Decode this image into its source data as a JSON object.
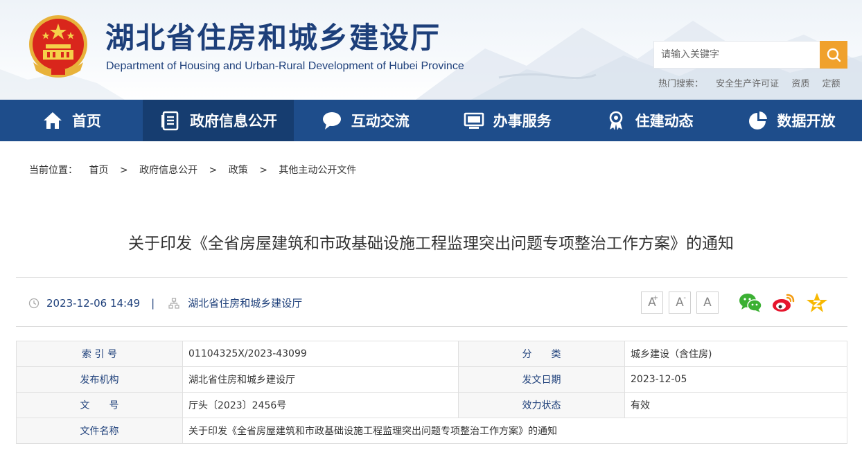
{
  "header": {
    "title": "湖北省住房和城乡建设厅",
    "subtitle": "Department of Housing and Urban-Rural Development of Hubei Province"
  },
  "search": {
    "placeholder": "请输入关键字",
    "hot_label": "热门搜索：",
    "hot_terms": [
      "安全生产许可证",
      "资质",
      "定额"
    ]
  },
  "nav": {
    "items": [
      {
        "label": "首页",
        "icon": "home-icon"
      },
      {
        "label": "政府信息公开",
        "icon": "document-list-icon"
      },
      {
        "label": "互动交流",
        "icon": "chat-bubble-icon"
      },
      {
        "label": "办事服务",
        "icon": "monitor-icon"
      },
      {
        "label": "住建动态",
        "icon": "award-icon"
      },
      {
        "label": "数据开放",
        "icon": "pie-chart-icon"
      }
    ],
    "active_index": 1
  },
  "breadcrumb": {
    "label": "当前位置：",
    "items": [
      "首页",
      "政府信息公开",
      "政策",
      "其他主动公开文件"
    ],
    "separator": ">"
  },
  "article": {
    "title": "关于印发《全省房屋建筑和市政基础设施工程监理突出问题专项整治工作方案》的通知",
    "datetime": "2023-12-06 14:49",
    "divider": "|",
    "source": "湖北省住房和城乡建设厅"
  },
  "font_controls": {
    "increase": "A",
    "increase_sup": "+",
    "decrease": "A",
    "decrease_sup": "-",
    "reset": "A"
  },
  "share": [
    "wechat-icon",
    "weibo-icon",
    "qzone-icon"
  ],
  "info_table": {
    "rows": [
      {
        "k1": "索 引 号",
        "v1": "01104325X/2023-43099",
        "k2": "分　　类",
        "v2": "城乡建设（含住房)"
      },
      {
        "k1": "发布机构",
        "v1": "湖北省住房和城乡建设厅",
        "k2": "发文日期",
        "v2": "2023-12-05"
      },
      {
        "k1": "文　　号",
        "v1": "厅头〔2023〕2456号",
        "k2": "效力状态",
        "v2": "有效"
      },
      {
        "k1": "文件名称",
        "v1": "关于印发《全省房屋建筑和市政基础设施工程监理突出问题专项整治工作方案》的通知"
      }
    ]
  },
  "colors": {
    "nav_bg": "#1e4d8b",
    "nav_active": "#163d70",
    "accent": "#f0a12c",
    "title_blue": "#1d3f7a"
  }
}
